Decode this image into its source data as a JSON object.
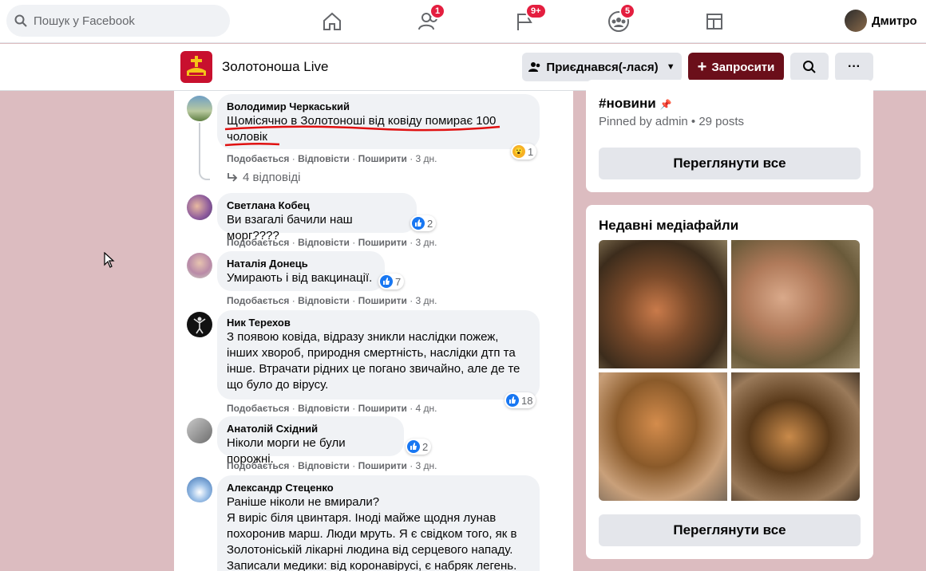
{
  "topnav": {
    "search_placeholder": "Пошук у Facebook",
    "friends_badge": "1",
    "pages_badge": "9+",
    "groups_badge": "5",
    "profile_name": "Дмитро"
  },
  "group": {
    "name": "Золотоноша Live",
    "joined_label": "Приєднався(-лася)",
    "invite_label": "Запросити"
  },
  "comments": [
    {
      "author": "Володимир Черкаський",
      "text_line1": "Щомісячно в Золотоноші від ковіду помирає 100",
      "text_line2": "чоловік",
      "reaction_count": "1",
      "time": "3 дн.",
      "replies": "4 відповіді"
    },
    {
      "author": "Светлана Кобец",
      "text": "Ви взагалі бачили наш морг????",
      "reaction_count": "2",
      "time": "3 дн."
    },
    {
      "author": "Наталія Донець",
      "text": "Умирають і від вакцинації.",
      "reaction_count": "7",
      "time": "3 дн."
    },
    {
      "author": "Ник Терехов",
      "lines": [
        "З появою ковіда, відразу зникли наслідки пожеж,",
        "інших хвороб, природня смертність, наслідки дтп та",
        "інше. Втрачати рідних це погано звичайно, але де те",
        "що було до вірусу."
      ],
      "reaction_count": "18",
      "time": "4 дн."
    },
    {
      "author": "Анатолій Східний",
      "text": "Ніколи морги не були порожні.",
      "reaction_count": "2",
      "time": "3 дн."
    },
    {
      "author": "Александр Стеценко",
      "lines": [
        "Раніше ніколи не вмирали?",
        "Я виріс біля цвинтаря. Іноді майже щодня лунав",
        "похоронив марш. Люди мруть. Я є свідком того, як в",
        "Золотоніській лікарні людина від серцевого нападу.",
        "Записали медики: від коронавірусі, є набряк легень."
      ]
    }
  ],
  "actions": {
    "like": "Подобається",
    "reply": "Відповісти",
    "share": "Поширити",
    "sep": " · "
  },
  "sidebar": {
    "hashtag": "#новини",
    "pinned_info": "Pinned by admin • 29 posts",
    "view_all": "Переглянути все",
    "media_title": "Недавні медіафайли",
    "media_view_all": "Переглянути все"
  },
  "colors": {
    "page_bg": "#dcbcc0",
    "invite_btn": "#6b0f1a",
    "like_blue": "#1877f2",
    "badge_red": "#e41e3f"
  }
}
